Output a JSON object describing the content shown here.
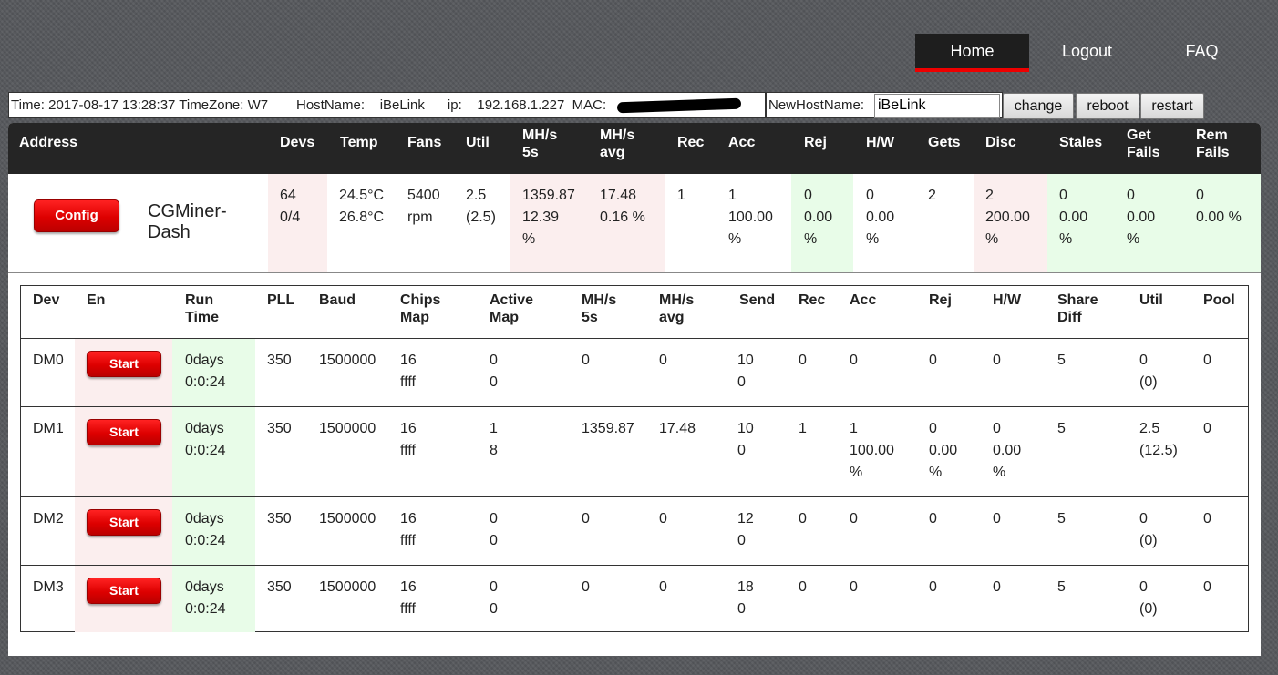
{
  "nav": {
    "home": "Home",
    "logout": "Logout",
    "faq": "FAQ"
  },
  "status": {
    "time_zone": "Time: 2017-08-17 13:28:37 TimeZone: W7",
    "host_ip_mac": "HostName:    iBeLink      ip:    192.168.1.227  MAC:",
    "new_hostname_label": "NewHostName:",
    "new_hostname_value": "iBeLink",
    "change": "change",
    "reboot": "reboot",
    "restart": "restart"
  },
  "colors": {
    "pink_cell": "#fbeeee",
    "green_cell": "#e8fce8",
    "header_bg": "#252525",
    "accent_red": "#dd0000"
  },
  "summary": {
    "headers": [
      "Address",
      "Devs",
      "Temp",
      "Fans",
      "Util",
      "MH/s\n5s",
      "MH/s\navg",
      "Rec",
      "Acc",
      "Rej",
      "H/W",
      "Gets",
      "Disc",
      "Stales",
      "Get\nFails",
      "Rem\nFails"
    ],
    "config_button": "Config",
    "app_name": "CGMiner-\nDash",
    "values": [
      "64\n0/4",
      "24.5°C\n26.8°C",
      "5400\nrpm",
      "2.5\n(2.5)",
      "1359.87\n12.39\n%",
      "17.48\n0.16 %",
      "1",
      "1\n100.00\n%",
      "0\n0.00\n%",
      "0\n0.00\n%",
      "2",
      "2\n200.00\n%",
      "0\n0.00\n%",
      "0\n0.00\n%",
      "0\n0.00 %"
    ]
  },
  "devices": {
    "headers": [
      "Dev",
      "En",
      "Run\nTime",
      "PLL",
      "Baud",
      "Chips\nMap",
      "Active\nMap",
      "MH/s\n5s",
      "MH/s\navg",
      "Send",
      "Rec",
      "Acc",
      "Rej",
      "H/W",
      "Share\nDiff",
      "Util",
      "Pool"
    ],
    "rows": [
      {
        "dev": "DM0",
        "btn": "Start",
        "runtime": "0days\n0:0:24",
        "pll": "350",
        "baud": "1500000",
        "chips": "16\nffff",
        "active": "0\n0",
        "mh5s": "0",
        "mhavg": "0",
        "send": "10\n0",
        "rec": "0",
        "acc": "0",
        "rej": "0",
        "hw": "0",
        "share": "5",
        "util": "0\n(0)",
        "pool": "0"
      },
      {
        "dev": "DM1",
        "btn": "Start",
        "runtime": "0days\n0:0:24",
        "pll": "350",
        "baud": "1500000",
        "chips": "16\nffff",
        "active": "1\n8",
        "mh5s": "1359.87",
        "mhavg": "17.48",
        "send": "10\n0",
        "rec": "1",
        "acc": "1\n100.00\n%",
        "rej": "0\n0.00\n%",
        "hw": "0\n0.00\n%",
        "share": "5",
        "util": "2.5\n(12.5)",
        "pool": "0"
      },
      {
        "dev": "DM2",
        "btn": "Start",
        "runtime": "0days\n0:0:24",
        "pll": "350",
        "baud": "1500000",
        "chips": "16\nffff",
        "active": "0\n0",
        "mh5s": "0",
        "mhavg": "0",
        "send": "12\n0",
        "rec": "0",
        "acc": "0",
        "rej": "0",
        "hw": "0",
        "share": "5",
        "util": "0\n(0)",
        "pool": "0"
      },
      {
        "dev": "DM3",
        "btn": "Start",
        "runtime": "0days\n0:0:24",
        "pll": "350",
        "baud": "1500000",
        "chips": "16\nffff",
        "active": "0\n0",
        "mh5s": "0",
        "mhavg": "0",
        "send": "18\n0",
        "rec": "0",
        "acc": "0",
        "rej": "0",
        "hw": "0",
        "share": "5",
        "util": "0\n(0)",
        "pool": "0"
      }
    ]
  }
}
